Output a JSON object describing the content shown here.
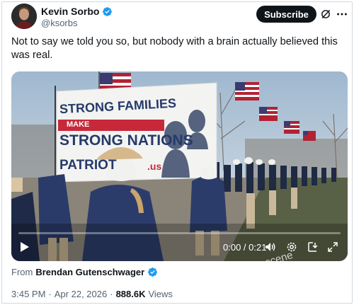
{
  "author": {
    "display_name": "Kevin Sorbo",
    "handle": "@ksorbs",
    "avatar_icon": "profile-photo"
  },
  "header": {
    "subscribe_label": "Subscribe",
    "grok_icon": "slash-circle-icon",
    "more_icon": "more-icon"
  },
  "tweet": {
    "text": "Not to say we told you so, but nobody with a brain actually believed this was real."
  },
  "video": {
    "banner_line1": "STRONG FAMILIES",
    "banner_make": "MAKE",
    "banner_line2": "STRONG NATIONS",
    "banner_line3": "PATRIOT",
    "banner_url": ".us",
    "watermark": "@bgonthescene",
    "time": "0:00 / 0:21",
    "progress": 0.0,
    "controls": [
      "play-icon",
      "volume-icon",
      "settings-icon",
      "download-icon",
      "fullscreen-icon"
    ]
  },
  "from": {
    "prefix": "From",
    "name": "Brendan Gutenschwager"
  },
  "meta": {
    "time": "3:45 PM",
    "separator": "·",
    "date": "Apr 22, 2026",
    "views_count": "888.6K",
    "views_label": "Views"
  },
  "colors": {
    "verified": "#1d9bf0",
    "subscribe_bg": "#0f1419",
    "secondary_text": "#536471"
  }
}
